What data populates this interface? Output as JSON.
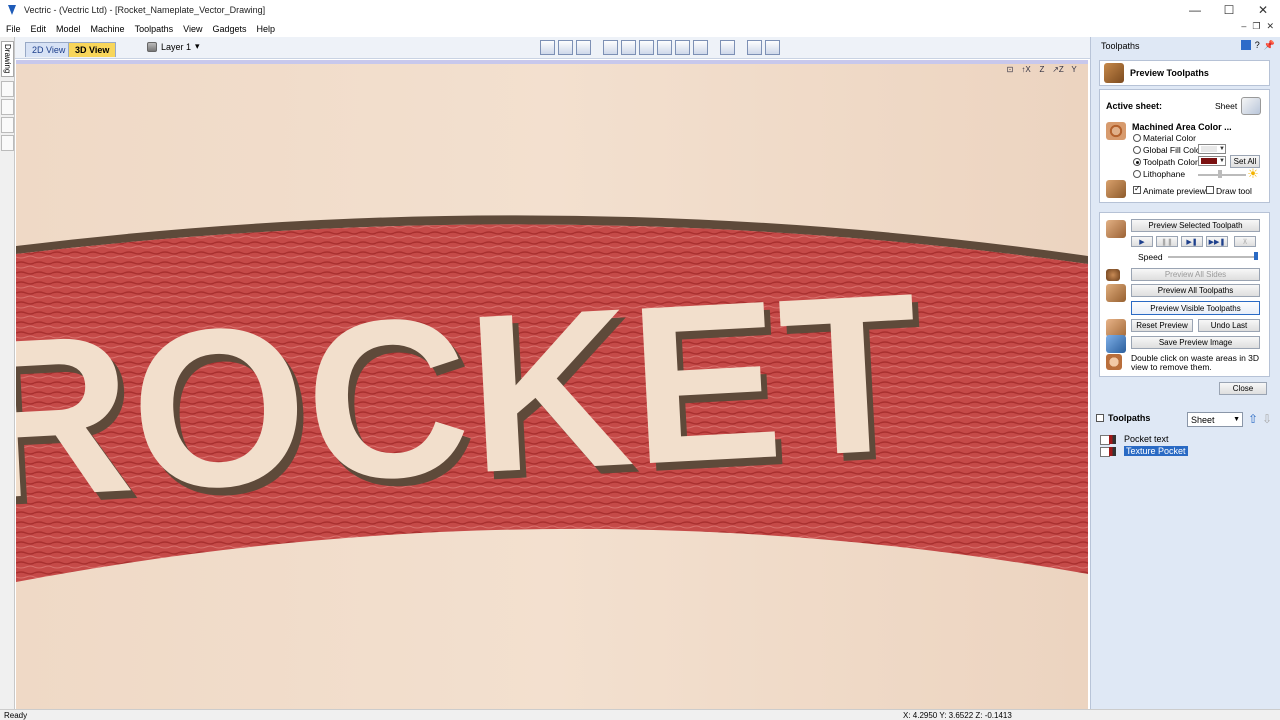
{
  "window": {
    "title": "Vectric - (Vectric Ltd) - [Rocket_Nameplate_Vector_Drawing]"
  },
  "menu": {
    "items": [
      "File",
      "Edit",
      "Model",
      "Machine",
      "Toolpaths",
      "View",
      "Gadgets",
      "Help"
    ]
  },
  "view_tabs": {
    "tab2d": "2D View",
    "tab3d": "3D View"
  },
  "layer": {
    "label": "Layer 1"
  },
  "left_strip": {
    "drawing_tab": "Drawing"
  },
  "viewport": {
    "text": "ROCKET",
    "view_icons": [
      "⊡",
      "↑X",
      "Z",
      "↗Z",
      "Y"
    ]
  },
  "right_panel": {
    "header": "Toolpaths",
    "preview_title": "Preview Toolpaths",
    "active_sheet_label": "Active sheet:",
    "sheet_label": "Sheet",
    "machined_area_title": "Machined Area Color ...",
    "options": {
      "material": "Material Color",
      "global_fill": "Global Fill Color",
      "toolpath": "Toolpath Color",
      "lithophane": "Lithophane",
      "selected": "toolpath"
    },
    "set_all": "Set All",
    "animate_preview": "Animate preview",
    "draw_tool": "Draw tool",
    "colors": {
      "global_fill": "#e8e8e8",
      "toolpath": "#7a1010",
      "accent": "#2a6ac4"
    },
    "buttons": {
      "preview_selected": "Preview Selected Toolpath",
      "speed": "Speed",
      "preview_all_sides": "Preview All Sides",
      "preview_all_toolpaths": "Preview All Toolpaths",
      "preview_visible": "Preview Visible Toolpaths",
      "reset_preview": "Reset Preview",
      "undo_last": "Undo Last",
      "save_preview_image": "Save Preview Image",
      "close": "Close"
    },
    "hint": "Double click on waste areas in 3D view to remove them.",
    "speed_level": 1.0,
    "playback_icons": [
      "▶",
      "❚❚",
      "▶❚",
      "▶▶❚",
      "⊼"
    ]
  },
  "toolpaths": {
    "title": "Toolpaths",
    "sheet_select": "Sheet",
    "items": [
      {
        "name": "Pocket text"
      },
      {
        "name": "Texture Pocket"
      }
    ]
  },
  "status": {
    "ready": "Ready",
    "coords": "X:  4.2950 Y:  3.6522 Z:  -0.1413"
  }
}
